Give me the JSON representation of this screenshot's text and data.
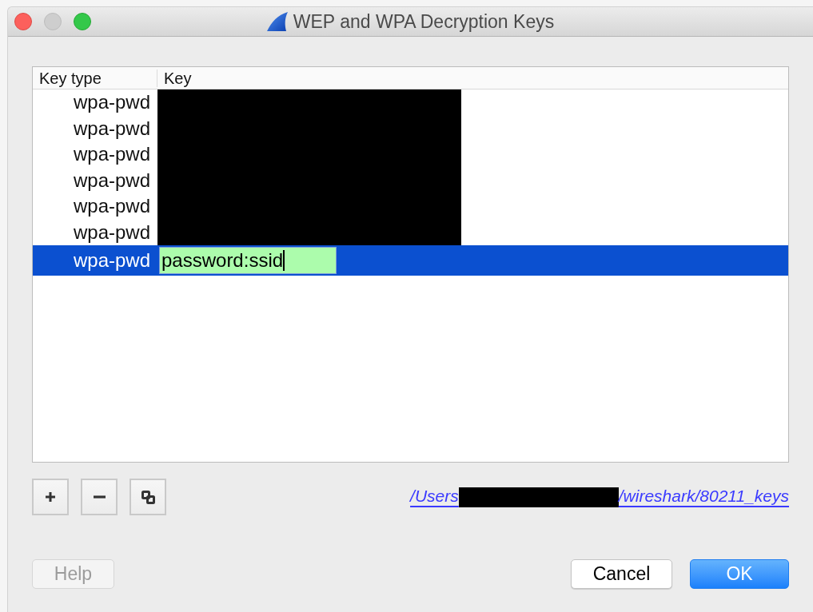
{
  "window": {
    "title": "WEP and WPA Decryption Keys",
    "controls": [
      {
        "kind": "close",
        "disabled": false
      },
      {
        "kind": "minimize",
        "disabled": true
      },
      {
        "kind": "zoom",
        "disabled": false
      }
    ]
  },
  "table": {
    "columns": [
      "Key type",
      "Key"
    ],
    "rows": [
      {
        "key_type": "wpa-pwd",
        "redacted": true,
        "selected": false
      },
      {
        "key_type": "wpa-pwd",
        "redacted": true,
        "selected": false
      },
      {
        "key_type": "wpa-pwd",
        "redacted": true,
        "selected": false
      },
      {
        "key_type": "wpa-pwd",
        "redacted": true,
        "selected": false
      },
      {
        "key_type": "wpa-pwd",
        "redacted": true,
        "selected": false
      },
      {
        "key_type": "wpa-pwd",
        "redacted": true,
        "selected": false
      },
      {
        "key_type": "wpa-pwd",
        "redacted": false,
        "selected": true,
        "key": "password:ssid",
        "editing": true
      }
    ]
  },
  "toolbar": [
    {
      "kind": "add"
    },
    {
      "kind": "remove"
    },
    {
      "kind": "copy"
    }
  ],
  "file_link": {
    "before": "/Users",
    "redacted": true,
    "after": "/wireshark/80211_keys"
  },
  "buttons": [
    {
      "label": "Help",
      "disabled": true,
      "default": false
    },
    {
      "label": "Cancel",
      "disabled": false,
      "default": false
    },
    {
      "label": "OK",
      "disabled": false,
      "default": true
    }
  ]
}
